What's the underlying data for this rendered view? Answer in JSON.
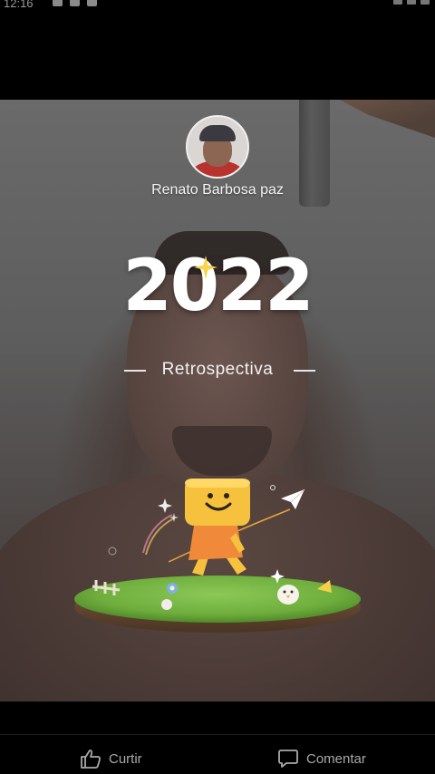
{
  "status_bar": {
    "time": "12:16"
  },
  "story": {
    "user_name": "Renato Barbosa paz",
    "year": "2022",
    "subtitle": "Retrospectiva"
  },
  "actions": {
    "like_label": "Curtir",
    "comment_label": "Comentar"
  },
  "colors": {
    "mascot_head": "#f6c23e",
    "mascot_body": "#f08a3a",
    "grass": "#6fae3d"
  },
  "icons": [
    "like-icon",
    "comment-icon",
    "sparkle-icon",
    "paper-plane-icon"
  ]
}
